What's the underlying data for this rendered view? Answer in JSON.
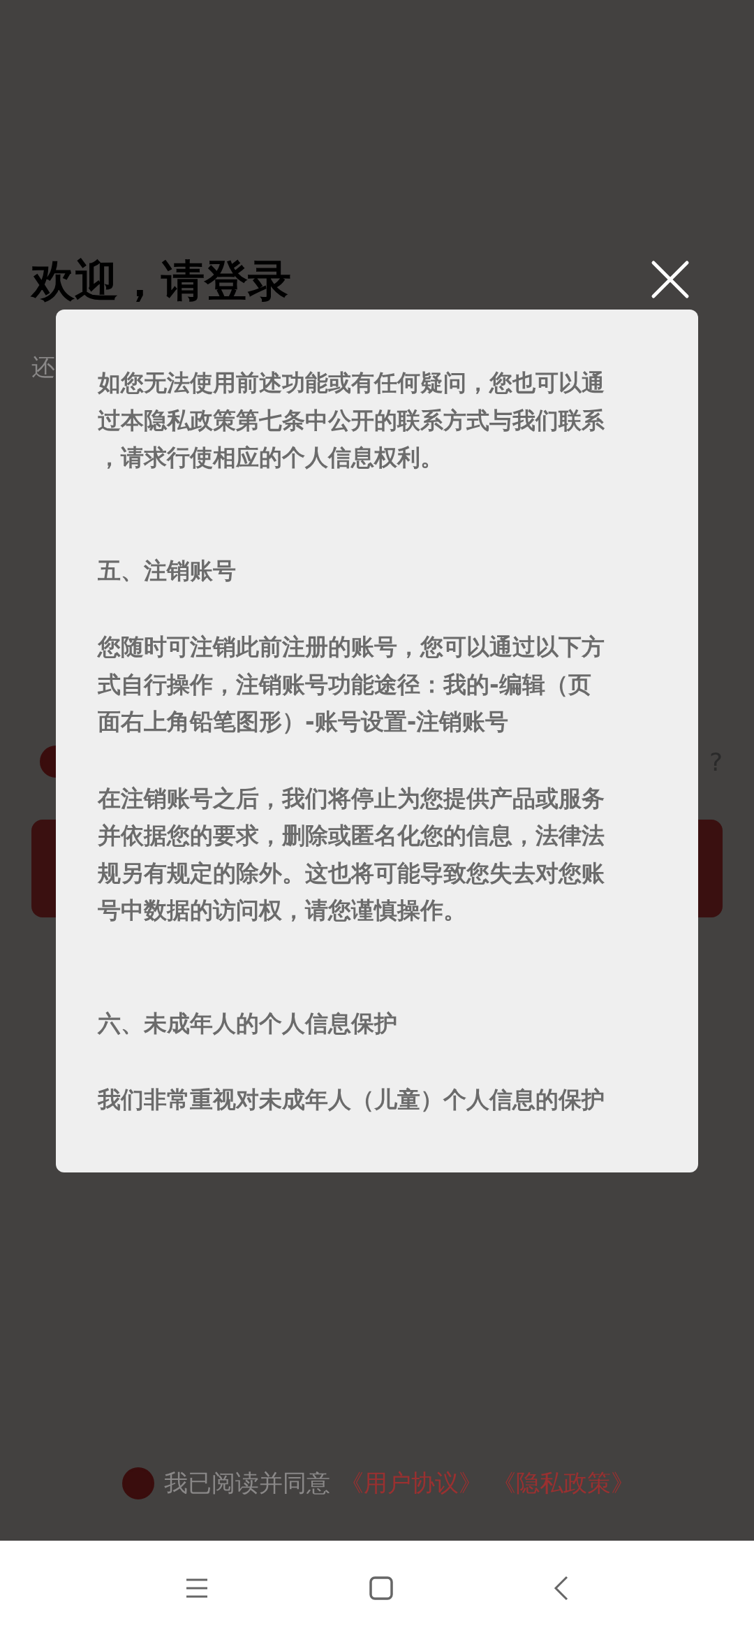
{
  "login_page": {
    "title": "欢迎，请登录",
    "subtitle": "还",
    "help_mark": "?",
    "remember_checked": true,
    "agreement": {
      "checked": true,
      "text": "我已阅读并同意",
      "links": [
        "《用户协议》",
        "《隐私政策》"
      ]
    }
  },
  "privacy_dialog": {
    "blocks": [
      {
        "kind": "paragraph",
        "lines": [
          "如您无法使用前述功能或有任何疑问，您也可以通",
          "过本隐私政策第七条中公开的联系方式与我们联系",
          "，请求行使相应的个人信息权利。"
        ]
      },
      {
        "kind": "heading",
        "lines": [
          "五、注销账号"
        ]
      },
      {
        "kind": "paragraph",
        "lines": [
          "您随时可注销此前注册的账号，您可以通过以下方",
          "式自行操作，注销账号功能途径：我的-编辑（页",
          "面右上角铅笔图形）-账号设置-注销账号"
        ]
      },
      {
        "kind": "paragraph",
        "lines": [
          "在注销账号之后，我们将停止为您提供产品或服务",
          "并依据您的要求，删除或匿名化您的信息，法律法",
          "规另有规定的除外。这也将可能导致您失去对您账",
          "号中数据的访问权，请您谨慎操作。"
        ]
      },
      {
        "kind": "heading",
        "lines": [
          "六、未成年人的个人信息保护"
        ]
      },
      {
        "kind": "paragraph",
        "lines": [
          "我们非常重视对未成年人（儿童）个人信息的保护"
        ]
      }
    ]
  }
}
